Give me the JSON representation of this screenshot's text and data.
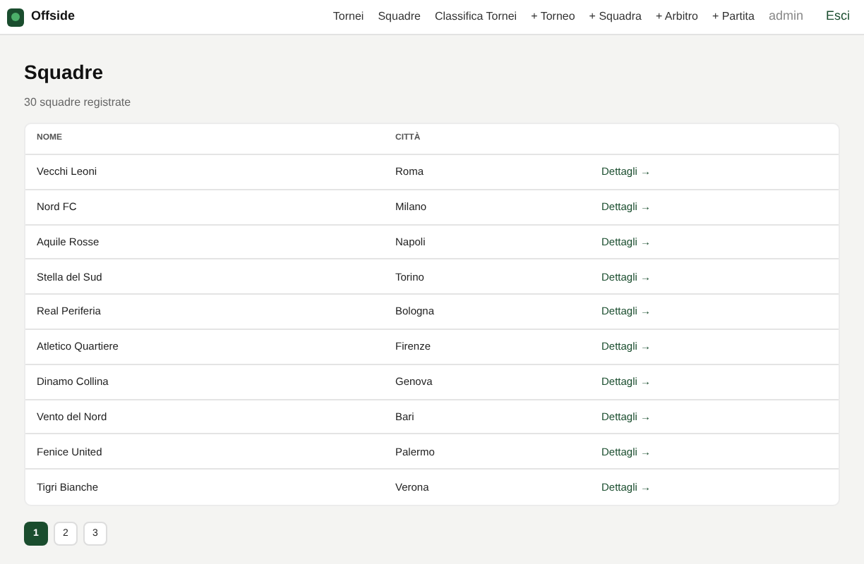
{
  "brand": "Offside",
  "nav": [
    {
      "label": "Tornei",
      "kind": "link"
    },
    {
      "label": "Squadre",
      "kind": "link"
    },
    {
      "label": "Classifica Tornei",
      "kind": "link"
    },
    {
      "label": "+ Torneo",
      "kind": "link"
    },
    {
      "label": "+ Squadra",
      "kind": "link"
    },
    {
      "label": "+ Arbitro",
      "kind": "link"
    },
    {
      "label": "+ Partita",
      "kind": "link"
    },
    {
      "label": "admin",
      "kind": "user"
    },
    {
      "label": "Esci",
      "kind": "logout"
    }
  ],
  "title": "Squadre",
  "subtitle": "30 squadre registrate",
  "table": {
    "columns": [
      "NOME",
      "CITTÀ"
    ],
    "rows": [
      {
        "name": "Vecchi Leoni",
        "city": "Roma",
        "action": "Dettagli →"
      },
      {
        "name": "Nord FC",
        "city": "Milano",
        "action": "Dettagli →"
      },
      {
        "name": "Aquile Rosse",
        "city": "Napoli",
        "action": "Dettagli →"
      },
      {
        "name": "Stella del Sud",
        "city": "Torino",
        "action": "Dettagli →"
      },
      {
        "name": "Real Periferia",
        "city": "Bologna",
        "action": "Dettagli →"
      },
      {
        "name": "Atletico Quartiere",
        "city": "Firenze",
        "action": "Dettagli →"
      },
      {
        "name": "Dinamo Collina",
        "city": "Genova",
        "action": "Dettagli →"
      },
      {
        "name": "Vento del Nord",
        "city": "Bari",
        "action": "Dettagli →"
      },
      {
        "name": "Fenice United",
        "city": "Palermo",
        "action": "Dettagli →"
      },
      {
        "name": "Tigri Bianche",
        "city": "Verona",
        "action": "Dettagli →"
      }
    ]
  },
  "pagination": [
    {
      "label": "1",
      "selected": true
    },
    {
      "label": "2",
      "selected": false
    },
    {
      "label": "3",
      "selected": false
    }
  ]
}
